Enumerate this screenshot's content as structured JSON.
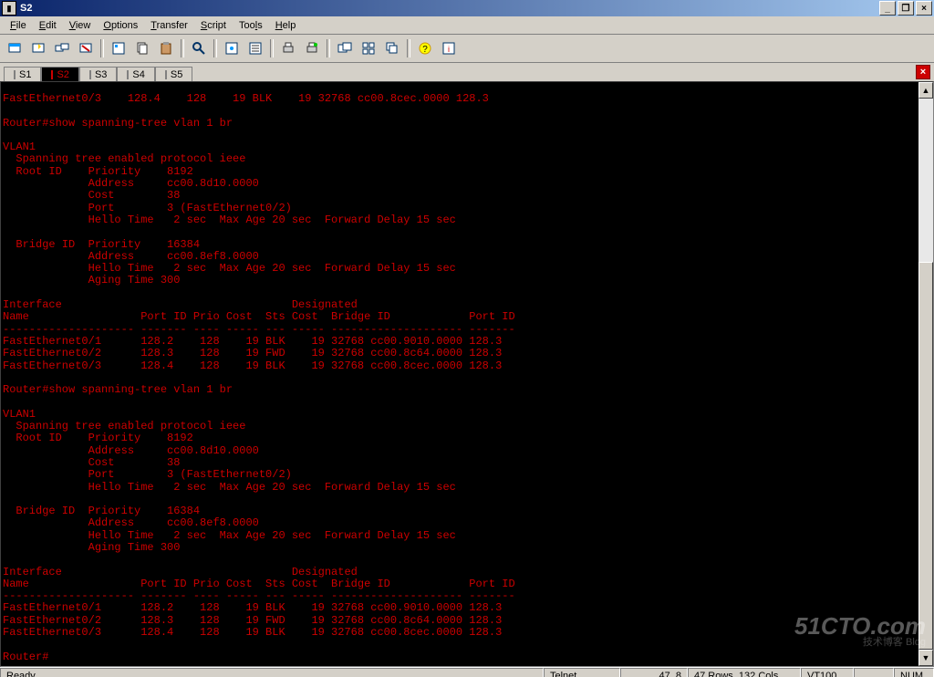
{
  "window": {
    "title": "S2",
    "minimize_glyph": "_",
    "restore_glyph": "❐",
    "close_glyph": "×"
  },
  "menu": {
    "items": [
      {
        "label": "File",
        "hotkey": "F"
      },
      {
        "label": "Edit",
        "hotkey": "E"
      },
      {
        "label": "View",
        "hotkey": "V"
      },
      {
        "label": "Options",
        "hotkey": "O"
      },
      {
        "label": "Transfer",
        "hotkey": "T"
      },
      {
        "label": "Script",
        "hotkey": "S"
      },
      {
        "label": "Tools",
        "hotkey": "T"
      },
      {
        "label": "Help",
        "hotkey": "H"
      }
    ]
  },
  "tabs": {
    "items": [
      {
        "label": "S1",
        "active": false
      },
      {
        "label": "S2",
        "active": true
      },
      {
        "label": "S3",
        "active": false
      },
      {
        "label": "S4",
        "active": false
      },
      {
        "label": "S5",
        "active": false
      }
    ],
    "close_glyph": "×"
  },
  "terminal": {
    "lines": [
      "FastEthernet0/3    128.4    128    19 BLK    19 32768 cc00.8cec.0000 128.3",
      "",
      "Router#show spanning-tree vlan 1 br",
      "",
      "VLAN1",
      "  Spanning tree enabled protocol ieee",
      "  Root ID    Priority    8192",
      "             Address     cc00.8d10.0000",
      "             Cost        38",
      "             Port        3 (FastEthernet0/2)",
      "             Hello Time   2 sec  Max Age 20 sec  Forward Delay 15 sec",
      "",
      "  Bridge ID  Priority    16384",
      "             Address     cc00.8ef8.0000",
      "             Hello Time   2 sec  Max Age 20 sec  Forward Delay 15 sec",
      "             Aging Time 300",
      "",
      "Interface                                   Designated",
      "Name                 Port ID Prio Cost  Sts Cost  Bridge ID            Port ID",
      "-------------------- ------- ---- ----- --- ----- -------------------- -------",
      "FastEthernet0/1      128.2    128    19 BLK    19 32768 cc00.9010.0000 128.3",
      "FastEthernet0/2      128.3    128    19 FWD    19 32768 cc00.8c64.0000 128.3",
      "FastEthernet0/3      128.4    128    19 BLK    19 32768 cc00.8cec.0000 128.3",
      "",
      "Router#show spanning-tree vlan 1 br",
      "",
      "VLAN1",
      "  Spanning tree enabled protocol ieee",
      "  Root ID    Priority    8192",
      "             Address     cc00.8d10.0000",
      "             Cost        38",
      "             Port        3 (FastEthernet0/2)",
      "             Hello Time   2 sec  Max Age 20 sec  Forward Delay 15 sec",
      "",
      "  Bridge ID  Priority    16384",
      "             Address     cc00.8ef8.0000",
      "             Hello Time   2 sec  Max Age 20 sec  Forward Delay 15 sec",
      "             Aging Time 300",
      "",
      "Interface                                   Designated",
      "Name                 Port ID Prio Cost  Sts Cost  Bridge ID            Port ID",
      "-------------------- ------- ---- ----- --- ----- -------------------- -------",
      "FastEthernet0/1      128.2    128    19 BLK    19 32768 cc00.9010.0000 128.3",
      "FastEthernet0/2      128.3    128    19 FWD    19 32768 cc00.8c64.0000 128.3",
      "FastEthernet0/3      128.4    128    19 BLK    19 32768 cc00.8cec.0000 128.3",
      "",
      "Router#"
    ]
  },
  "statusbar": {
    "ready": "Ready",
    "protocol": "Telnet",
    "cursor": "47,   8",
    "size": "47 Rows, 132 Cols",
    "term": "VT100",
    "caps": "",
    "num": "NUM"
  },
  "watermark": {
    "main": "51CTO.com",
    "sub": "技术博客   Blog"
  }
}
